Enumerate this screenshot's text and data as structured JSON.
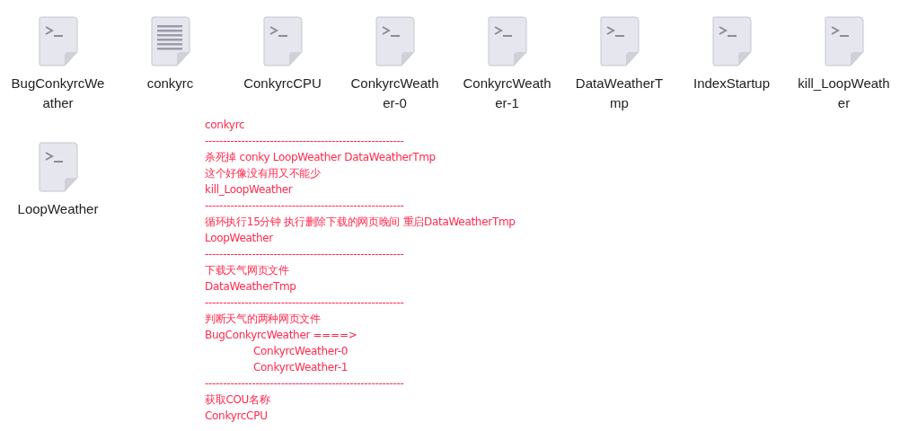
{
  "files": [
    {
      "name": "BugConkyrcWeather",
      "kind": "script"
    },
    {
      "name": "conkyrc",
      "kind": "text"
    },
    {
      "name": "ConkyrcCPU",
      "kind": "script"
    },
    {
      "name": "ConkyrcWeather-0",
      "kind": "script"
    },
    {
      "name": "ConkyrcWeather-1",
      "kind": "script"
    },
    {
      "name": "DataWeatherTmp",
      "kind": "script"
    },
    {
      "name": "IndexStartup",
      "kind": "script"
    },
    {
      "name": "kill_LoopWeather",
      "kind": "script"
    },
    {
      "name": "LoopWeather",
      "kind": "script"
    }
  ],
  "note": [
    {
      "text": "conkyrc",
      "kind": "line"
    },
    {
      "text": "-------------------------------------------------------",
      "kind": "line"
    },
    {
      "text": "杀死掉 conky LoopWeather DataWeatherTmp",
      "kind": "line"
    },
    {
      "text": "这个好像没有用又不能少",
      "kind": "line"
    },
    {
      "text": "kill_LoopWeather",
      "kind": "line"
    },
    {
      "text": "-------------------------------------------------------",
      "kind": "line"
    },
    {
      "text": "循环执行15分钟 执行删除下载的网页晚间 重启DataWeatherTmp",
      "kind": "line"
    },
    {
      "text": "LoopWeather",
      "kind": "line"
    },
    {
      "text": "-------------------------------------------------------",
      "kind": "line"
    },
    {
      "text": "下载天气网页文件",
      "kind": "line"
    },
    {
      "text": "DataWeatherTmp",
      "kind": "line"
    },
    {
      "text": "-------------------------------------------------------",
      "kind": "line"
    },
    {
      "text": "判断天气的两种网页文件",
      "kind": "line"
    },
    {
      "text": "BugConkyrcWeather ====>",
      "kind": "line"
    },
    {
      "text": "ConkyrcWeather-0",
      "kind": "indented"
    },
    {
      "text": "ConkyrcWeather-1",
      "kind": "indented"
    },
    {
      "text": "-------------------------------------------------------",
      "kind": "line"
    },
    {
      "text": "获取COU名称",
      "kind": "line"
    },
    {
      "text": "ConkyrcCPU",
      "kind": "line"
    }
  ]
}
